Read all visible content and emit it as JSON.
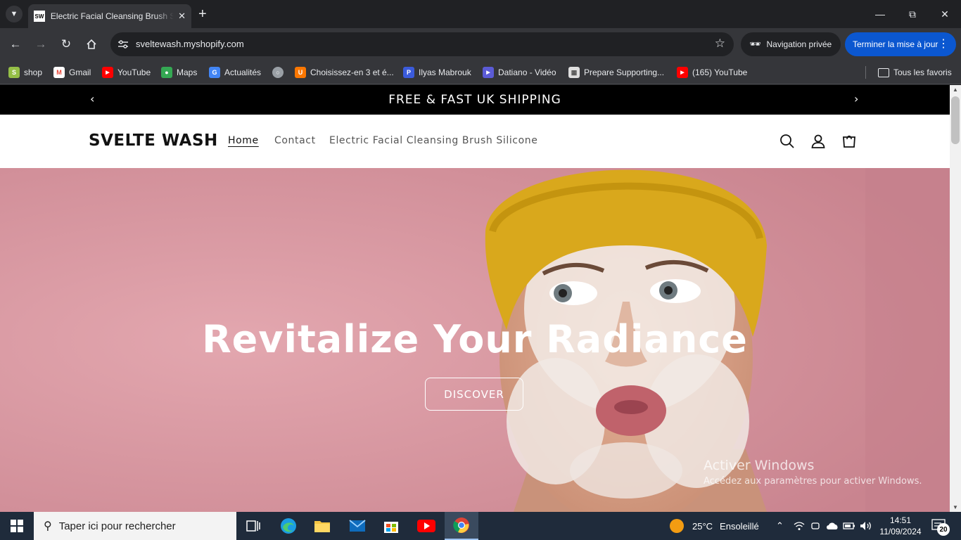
{
  "browser": {
    "tab": {
      "favicon_text": "SW",
      "title": "Electric Facial Cleansing Brush Silicone – Svelte Wash"
    },
    "url": "sveltewash.myshopify.com",
    "incognito_label": "Navigation privée",
    "update_label": "Terminer la mise à jour"
  },
  "bookmarks": {
    "items": [
      {
        "label": "shop",
        "icon": "shopify-icon",
        "color": "#95bf47"
      },
      {
        "label": "Gmail",
        "icon": "gmail-icon",
        "color": "#ea4335"
      },
      {
        "label": "YouTube",
        "icon": "youtube-icon",
        "color": "#ff0000"
      },
      {
        "label": "Maps",
        "icon": "maps-icon",
        "color": "#34a853"
      },
      {
        "label": "Actualités",
        "icon": "google-news-icon",
        "color": "#4285f4"
      },
      {
        "label": "",
        "icon": "globe-icon",
        "color": "#9aa0a6"
      },
      {
        "label": "Choisissez-en 3 et é...",
        "icon": "temu-icon",
        "color": "#fb7701"
      },
      {
        "label": "Ilyas Mabrouk",
        "icon": "p-app-icon",
        "color": "#3b5bdb"
      },
      {
        "label": "Datiano - Vidéo",
        "icon": "video-icon",
        "color": "#5b5bd6"
      },
      {
        "label": "Prepare Supporting...",
        "icon": "document-icon",
        "color": "#dfdfdf"
      },
      {
        "label": "(165) YouTube",
        "icon": "youtube-icon",
        "color": "#ff0000"
      }
    ],
    "all_label": "Tous les favoris"
  },
  "store": {
    "announcement": "FREE & FAST UK SHIPPING",
    "logo": "SVELTE WASH",
    "nav": [
      "Home",
      "Contact",
      "Electric Facial Cleansing Brush Silicone"
    ],
    "hero": {
      "title": "Revitalize Your Radiance",
      "button": "DISCOVER"
    }
  },
  "watermark": {
    "title": "Activer Windows",
    "subtitle": "Accédez aux paramètres pour activer Windows."
  },
  "taskbar": {
    "search_placeholder": "Taper ici pour rechercher",
    "weather": {
      "temp": "25°C",
      "condition": "Ensoleillé"
    },
    "time": "14:51",
    "date": "11/09/2024",
    "notifications": "20"
  },
  "colors": {
    "hero_pink": "#d99aa4",
    "announcement_bg": "#000000",
    "update_blue": "#0b57d0",
    "taskbar_bg": "#1f2b3b"
  }
}
